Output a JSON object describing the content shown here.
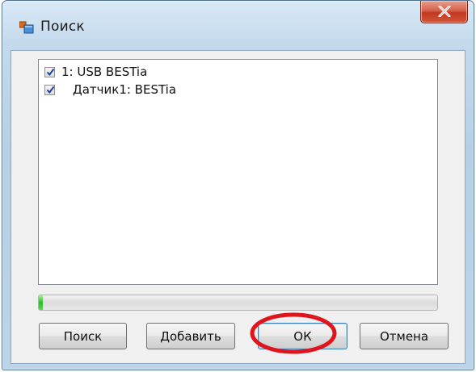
{
  "window": {
    "title": "Поиск",
    "close_symbol": "✕"
  },
  "device_list": {
    "items": [
      {
        "label": "1: USB BESTia",
        "checked": true
      },
      {
        "label": "Датчик1: BESTia",
        "checked": true
      }
    ]
  },
  "progress": {
    "value_fraction": 0.01,
    "color": "#2fb82a"
  },
  "buttons": {
    "search_label": "Поиск",
    "add_label": "Добавить",
    "ok_label": "ОК",
    "cancel_label": "Отмена"
  },
  "annotation": {
    "highlight_color": "#e0141c"
  },
  "icons": {
    "app": "window-app-icon",
    "close": "close-icon",
    "check": "check-icon"
  }
}
